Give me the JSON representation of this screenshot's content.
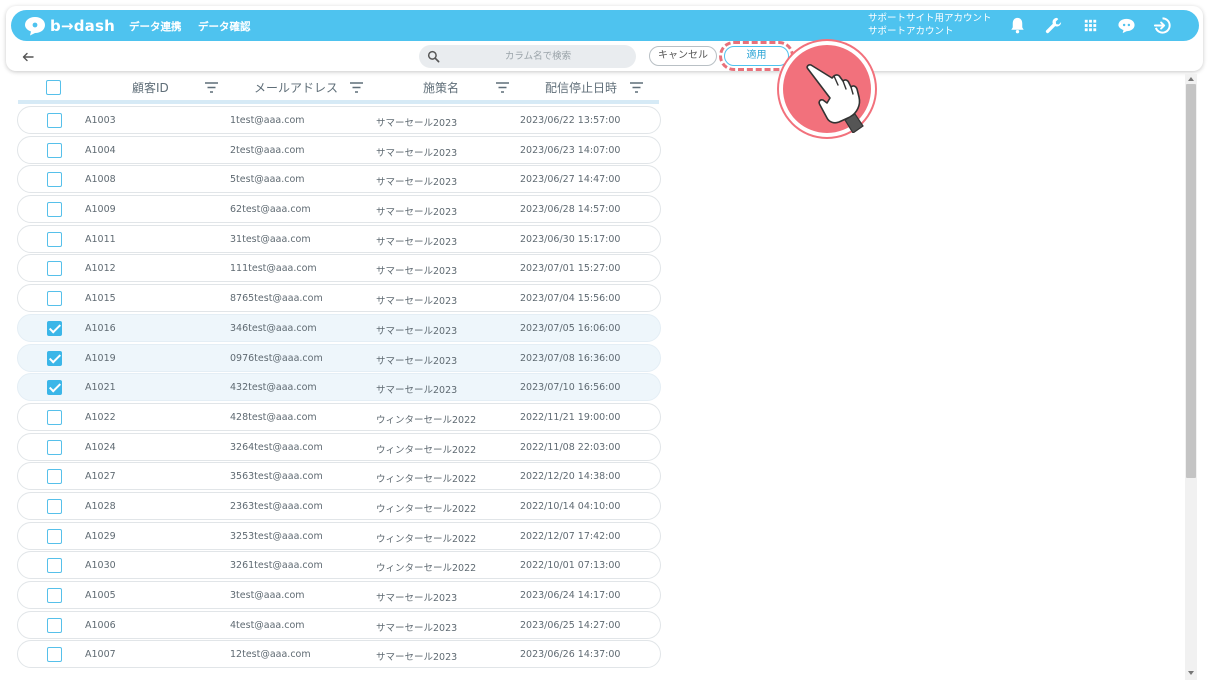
{
  "app": {
    "logo_text": "b→dash",
    "nav": [
      "データ連携",
      "データ確認"
    ],
    "account_line1": "サポートサイト用アカウント",
    "account_line2": "サポートアカウント",
    "brand_color": "#4ec3ef"
  },
  "toolbar": {
    "search_placeholder": "カラム名で検索",
    "cancel_label": "キャンセル",
    "apply_label": "適用"
  },
  "table": {
    "columns": [
      "顧客ID",
      "メールアドレス",
      "施策名",
      "配信停止日時"
    ],
    "rows": [
      {
        "checked": false,
        "id": "A1003",
        "email": "1test@aaa.com",
        "campaign": "サマーセール2023",
        "date": "2023/06/22 13:57:00"
      },
      {
        "checked": false,
        "id": "A1004",
        "email": "2test@aaa.com",
        "campaign": "サマーセール2023",
        "date": "2023/06/23 14:07:00"
      },
      {
        "checked": false,
        "id": "A1008",
        "email": "5test@aaa.com",
        "campaign": "サマーセール2023",
        "date": "2023/06/27 14:47:00"
      },
      {
        "checked": false,
        "id": "A1009",
        "email": "62test@aaa.com",
        "campaign": "サマーセール2023",
        "date": "2023/06/28 14:57:00"
      },
      {
        "checked": false,
        "id": "A1011",
        "email": "31test@aaa.com",
        "campaign": "サマーセール2023",
        "date": "2023/06/30 15:17:00"
      },
      {
        "checked": false,
        "id": "A1012",
        "email": "111test@aaa.com",
        "campaign": "サマーセール2023",
        "date": "2023/07/01 15:27:00"
      },
      {
        "checked": false,
        "id": "A1015",
        "email": "8765test@aaa.com",
        "campaign": "サマーセール2023",
        "date": "2023/07/04 15:56:00"
      },
      {
        "checked": true,
        "id": "A1016",
        "email": "346test@aaa.com",
        "campaign": "サマーセール2023",
        "date": "2023/07/05 16:06:00"
      },
      {
        "checked": true,
        "id": "A1019",
        "email": "0976test@aaa.com",
        "campaign": "サマーセール2023",
        "date": "2023/07/08 16:36:00"
      },
      {
        "checked": true,
        "id": "A1021",
        "email": "432test@aaa.com",
        "campaign": "サマーセール2023",
        "date": "2023/07/10 16:56:00"
      },
      {
        "checked": false,
        "id": "A1022",
        "email": "428test@aaa.com",
        "campaign": "ウィンターセール2022",
        "date": "2022/11/21 19:00:00"
      },
      {
        "checked": false,
        "id": "A1024",
        "email": "3264test@aaa.com",
        "campaign": "ウィンターセール2022",
        "date": "2022/11/08 22:03:00"
      },
      {
        "checked": false,
        "id": "A1027",
        "email": "3563test@aaa.com",
        "campaign": "ウィンターセール2022",
        "date": "2022/12/20 14:38:00"
      },
      {
        "checked": false,
        "id": "A1028",
        "email": "2363test@aaa.com",
        "campaign": "ウィンターセール2022",
        "date": "2022/10/14 04:10:00"
      },
      {
        "checked": false,
        "id": "A1029",
        "email": "3253test@aaa.com",
        "campaign": "ウィンターセール2022",
        "date": "2022/12/07 17:42:00"
      },
      {
        "checked": false,
        "id": "A1030",
        "email": "3261test@aaa.com",
        "campaign": "ウィンターセール2022",
        "date": "2022/10/01 07:13:00"
      },
      {
        "checked": false,
        "id": "A1005",
        "email": "3test@aaa.com",
        "campaign": "サマーセール2023",
        "date": "2023/06/24 14:17:00"
      },
      {
        "checked": false,
        "id": "A1006",
        "email": "4test@aaa.com",
        "campaign": "サマーセール2023",
        "date": "2023/06/25 14:27:00"
      },
      {
        "checked": false,
        "id": "A1007",
        "email": "12test@aaa.com",
        "campaign": "サマーセール2023",
        "date": "2023/06/26 14:37:00"
      }
    ]
  },
  "icons": {
    "back": "arrow-left-icon",
    "search": "search-icon",
    "bell": "bell-icon",
    "wrench": "wrench-icon",
    "grid": "grid-icon",
    "chat": "chat-bot-icon",
    "logout": "logout-icon",
    "filter": "filter-icon",
    "hand": "pointing-hand-icon"
  }
}
